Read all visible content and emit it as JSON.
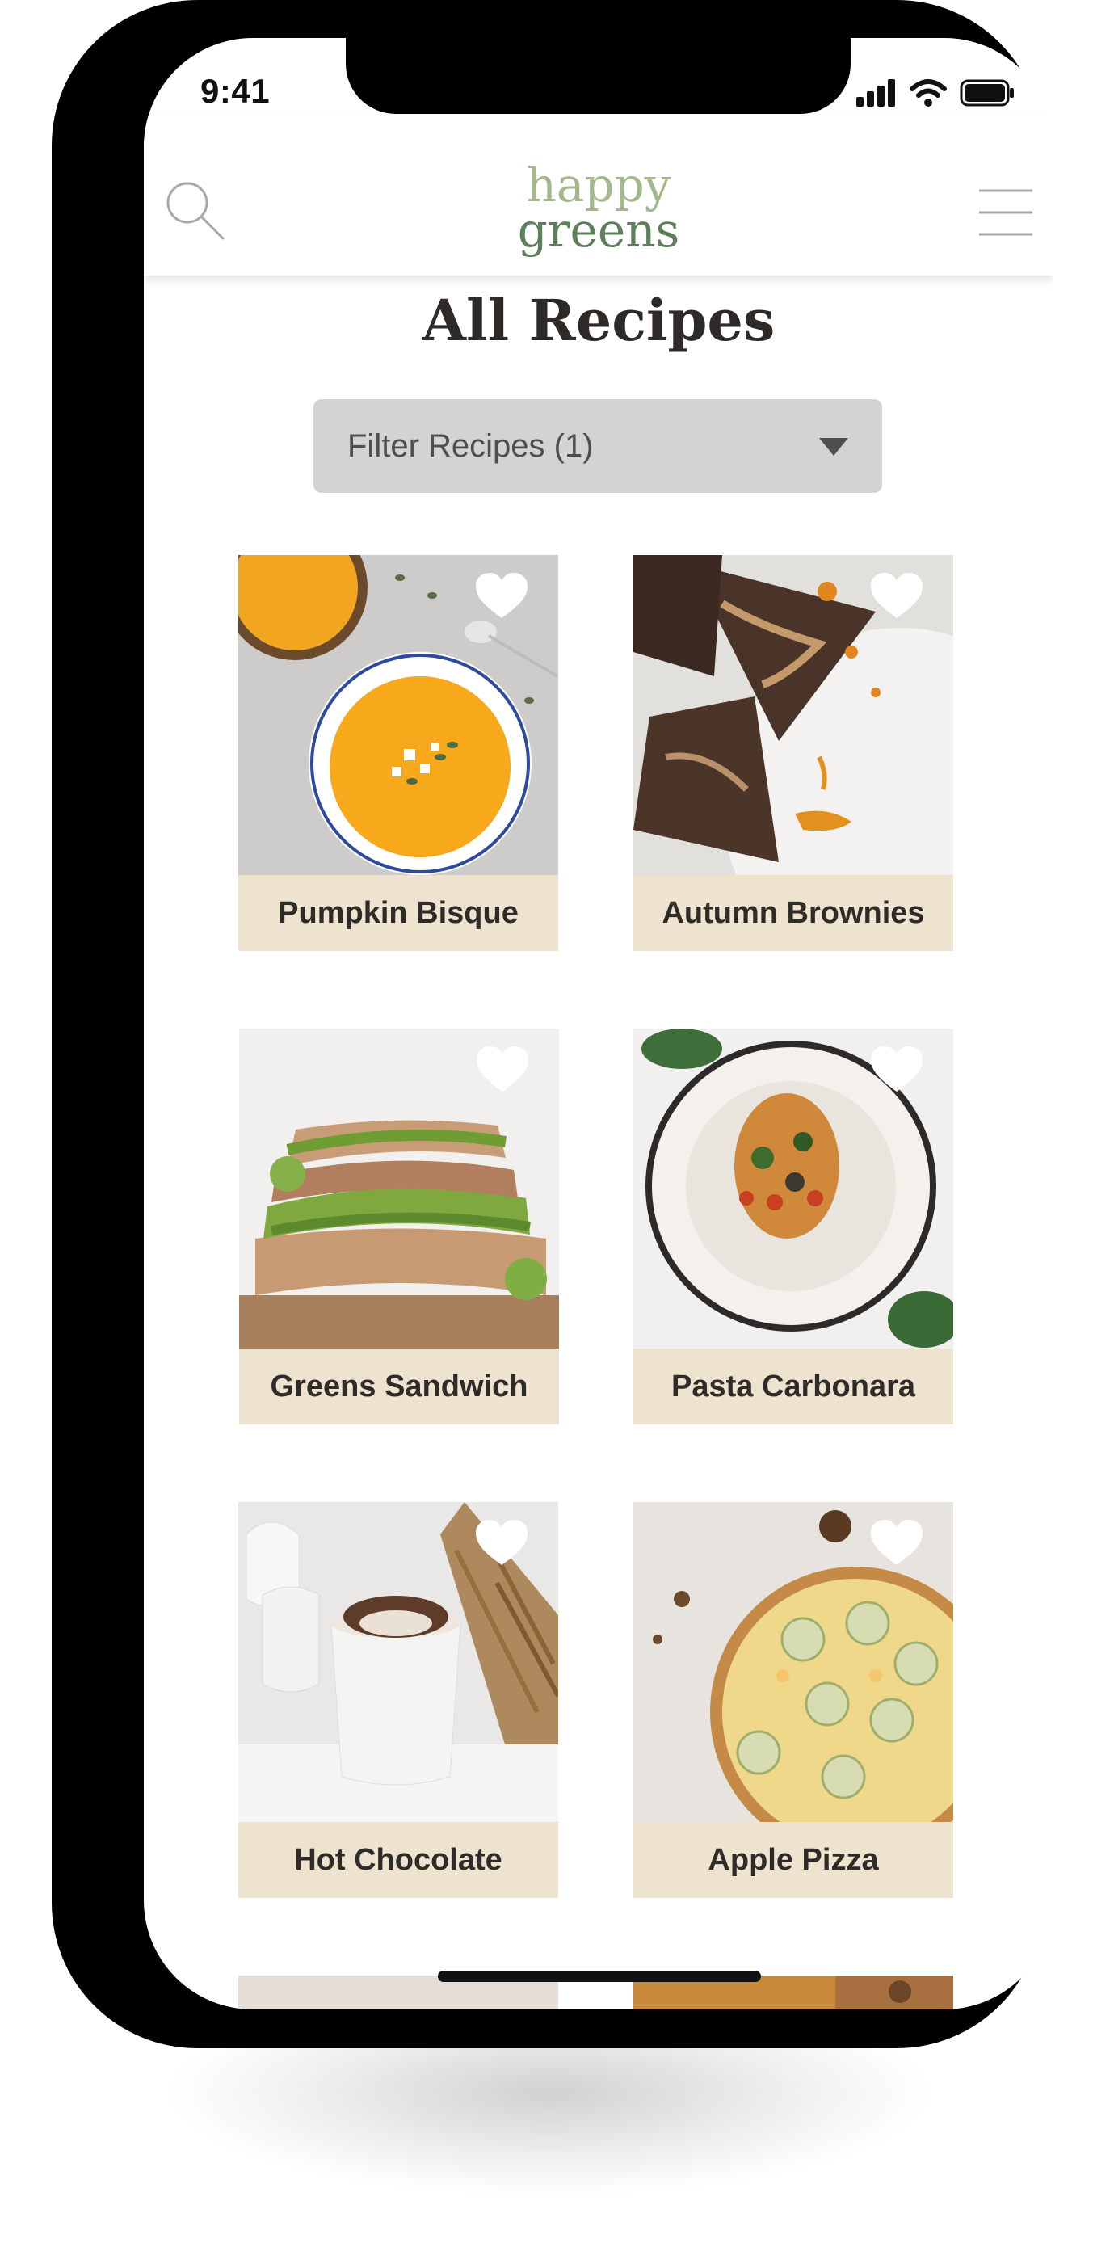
{
  "status_bar": {
    "time": "9:41"
  },
  "header": {
    "logo_line1": "happy",
    "logo_line2": "greens",
    "search_icon": "search-icon",
    "menu_icon": "hamburger-menu-icon"
  },
  "page": {
    "title": "All Recipes"
  },
  "filter": {
    "label": "Filter Recipes (1)"
  },
  "recipes": [
    {
      "name": "Pumpkin Bisque"
    },
    {
      "name": "Autumn Brownies"
    },
    {
      "name": "Greens Sandwich"
    },
    {
      "name": "Pasta Carbonara"
    },
    {
      "name": "Hot Chocolate"
    },
    {
      "name": "Apple Pizza"
    }
  ],
  "colors": {
    "label_bg": "#ede3cf",
    "logo_light": "#a3b88d",
    "logo_dark": "#5f7f5c",
    "filter_bg": "#d3d4d2"
  }
}
